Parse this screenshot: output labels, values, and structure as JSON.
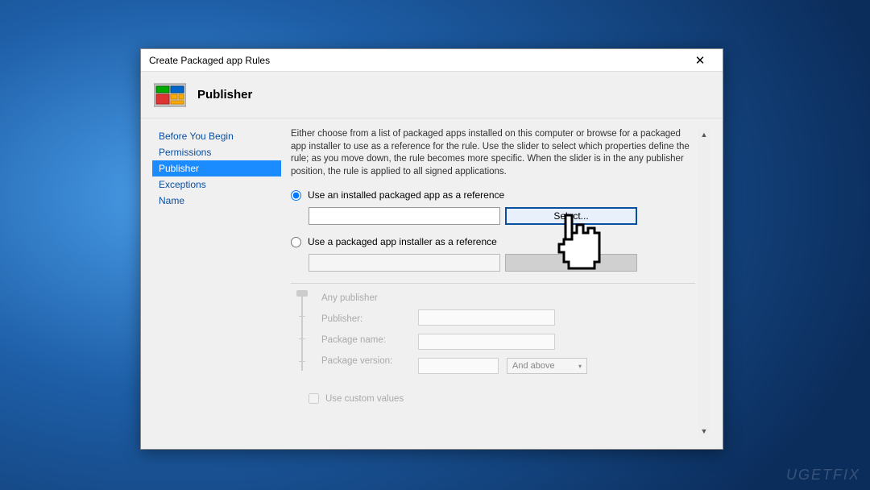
{
  "window": {
    "title": "Create Packaged app Rules"
  },
  "header": {
    "title": "Publisher"
  },
  "sidebar": {
    "items": [
      {
        "label": "Before You Begin",
        "selected": false
      },
      {
        "label": "Permissions",
        "selected": false
      },
      {
        "label": "Publisher",
        "selected": true
      },
      {
        "label": "Exceptions",
        "selected": false
      },
      {
        "label": "Name",
        "selected": false
      }
    ]
  },
  "content": {
    "description": "Either choose from a list of packaged apps installed on this computer or browse for a packaged app installer to use as a reference for the rule. Use the slider to select which properties define the rule; as you move down, the rule becomes more specific. When the slider is in the any publisher position, the rule is applied to all signed applications.",
    "option1": {
      "label": "Use an installed packaged app as a reference",
      "button": "Select..."
    },
    "option2": {
      "label": "Use a packaged app installer as a reference",
      "button": "Browse..."
    },
    "properties": {
      "any_publisher": "Any publisher",
      "publisher": "Publisher:",
      "package_name": "Package name:",
      "package_version": "Package version:",
      "and_above": "And above"
    },
    "custom_values": "Use custom values"
  },
  "watermark": "UGETFIX"
}
